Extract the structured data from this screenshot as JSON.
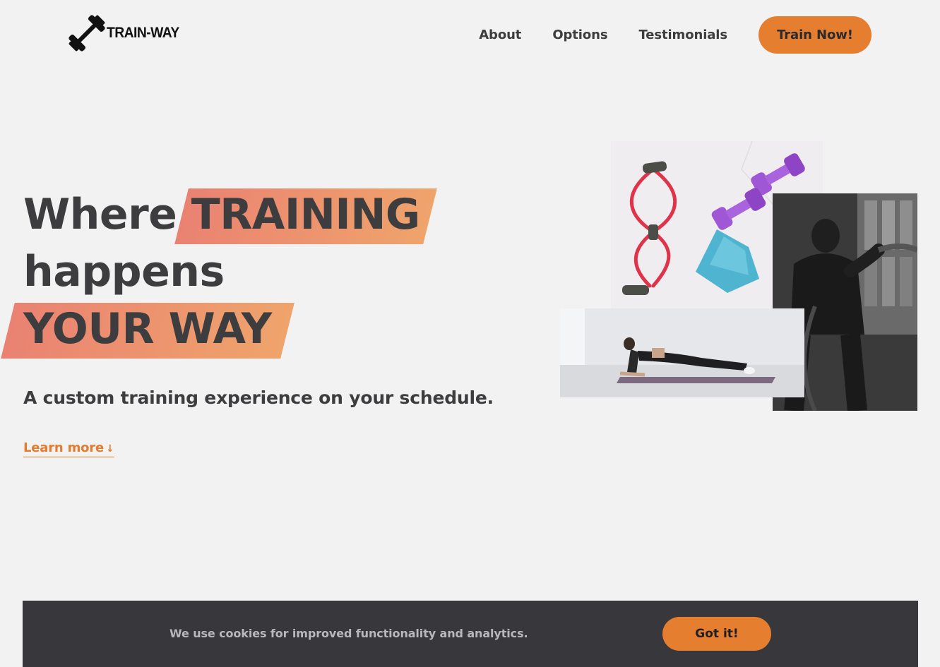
{
  "brand": {
    "logo_text": "TRAIN-WAY",
    "logo_icon": "dumbbell-icon"
  },
  "nav": {
    "links": [
      "About",
      "Options",
      "Testimonials"
    ],
    "cta_label": "Train Now!"
  },
  "hero": {
    "title_word_1": "Where",
    "title_highlight_1": "TRAINING",
    "title_word_2": "happens",
    "title_highlight_2": "YOUR WAY",
    "subtitle": "A custom training experience on your schedule.",
    "learn_more_label": "Learn more",
    "learn_more_arrow": "↓"
  },
  "cookie_banner": {
    "message": "We use cookies for improved functionality and analytics.",
    "button_label": "Got it!"
  },
  "colors": {
    "accent": "#e67e30",
    "text": "#3d3d3f",
    "background": "#f3f2f2",
    "banner": "#38383c",
    "highlight_start": "#ea8272",
    "highlight_end": "#efa46b"
  }
}
